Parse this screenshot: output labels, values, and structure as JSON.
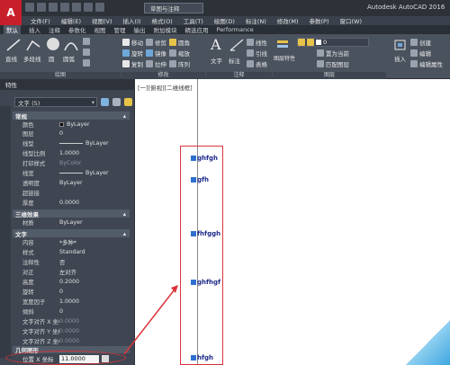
{
  "app": {
    "logo": "A",
    "workspace": "草图与注释",
    "title": "Autodesk AutoCAD 2016"
  },
  "menu": [
    "文件(F)",
    "编辑(E)",
    "视图(V)",
    "插入(I)",
    "格式(O)",
    "工具(T)",
    "绘图(D)",
    "标注(N)",
    "修改(M)",
    "参数(P)",
    "窗口(W)"
  ],
  "tabs": [
    "默认",
    "插入",
    "注释",
    "参数化",
    "视图",
    "管理",
    "输出",
    "附加模块",
    "精选应用",
    "Performance"
  ],
  "ribbon": {
    "draw": {
      "line": "直线",
      "polyline": "多段线",
      "circle": "圆",
      "arc": "圆弧",
      "panel": "绘图"
    },
    "modify": {
      "move": "移动",
      "rotate": "旋转",
      "copy": "复制",
      "mirror": "镜像",
      "stretch": "拉伸",
      "scale": "缩放",
      "trim": "修剪",
      "fillet": "圆角",
      "array": "阵列",
      "panel": "修改"
    },
    "annotation": {
      "text": "文字",
      "dim": "标注",
      "linear": "线性",
      "leader": "引线",
      "table": "表格",
      "panel": "注释"
    },
    "layers": {
      "props": "图层特性",
      "layer_value": "0",
      "make_current": "置为当前",
      "match": "匹配图层",
      "panel": "图层"
    },
    "block": {
      "insert": "插入",
      "create": "创建",
      "edit": "编辑",
      "edit_attr": "编辑属性"
    }
  },
  "properties": {
    "header": "特性",
    "selection": "文字 (5)",
    "sections": {
      "general": "常规",
      "3d": "三维效果",
      "text": "文字",
      "geometry": "几何图形"
    },
    "general_rows": [
      {
        "k": "颜色",
        "v": "ByLayer"
      },
      {
        "k": "图层",
        "v": "0"
      },
      {
        "k": "线型",
        "v": "ByLayer"
      },
      {
        "k": "线型比例",
        "v": "1.0000"
      },
      {
        "k": "打印样式",
        "v": "ByColor"
      },
      {
        "k": "线宽",
        "v": "ByLayer"
      },
      {
        "k": "透明度",
        "v": "ByLayer"
      },
      {
        "k": "超链接",
        "v": ""
      },
      {
        "k": "厚度",
        "v": "0.0000"
      }
    ],
    "d3_rows": [
      {
        "k": "材质",
        "v": "ByLayer"
      }
    ],
    "text_rows": [
      {
        "k": "内容",
        "v": "*多种*"
      },
      {
        "k": "样式",
        "v": "Standard"
      },
      {
        "k": "注释性",
        "v": "否"
      },
      {
        "k": "对正",
        "v": "左对齐"
      },
      {
        "k": "高度",
        "v": "0.2000"
      },
      {
        "k": "旋转",
        "v": "0"
      },
      {
        "k": "宽度因子",
        "v": "1.0000"
      },
      {
        "k": "倾斜",
        "v": "0"
      },
      {
        "k": "文字对齐 X 坐标",
        "v": "0.0000"
      },
      {
        "k": "文字对齐 Y 坐标",
        "v": "0.0000"
      },
      {
        "k": "文字对齐 Z 坐标",
        "v": "0.0000"
      }
    ],
    "position_x": {
      "k": "位置 X 坐标",
      "v": "11.0000"
    }
  },
  "canvas": {
    "view_label": "[一][俯视][二维线框]",
    "texts": [
      "ghfgh",
      "gfh",
      "fhfggh",
      "ghfhgf",
      "hfgh"
    ]
  }
}
